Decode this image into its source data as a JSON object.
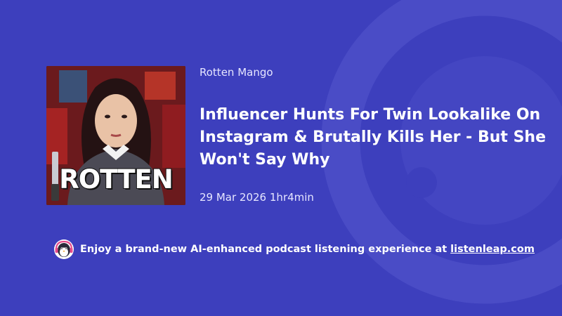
{
  "podcast": {
    "name": "Rotten Mango"
  },
  "episode": {
    "title": "Influencer Hunts For Twin Lookalike On Instagram & Brutally Kills Her - But She Won't Say Why",
    "date": "29 Mar 2026",
    "duration": "1hr4min"
  },
  "cover": {
    "title": "ROTTEN",
    "icon": "podcast-cover-art"
  },
  "promo": {
    "text": "Enjoy a brand-new AI-enhanced podcast listening experience at",
    "link_label": "listenleap.com",
    "icon": "penguin-headphones-icon"
  },
  "colors": {
    "background": "#3d3fbd",
    "text": "#ffffff"
  }
}
